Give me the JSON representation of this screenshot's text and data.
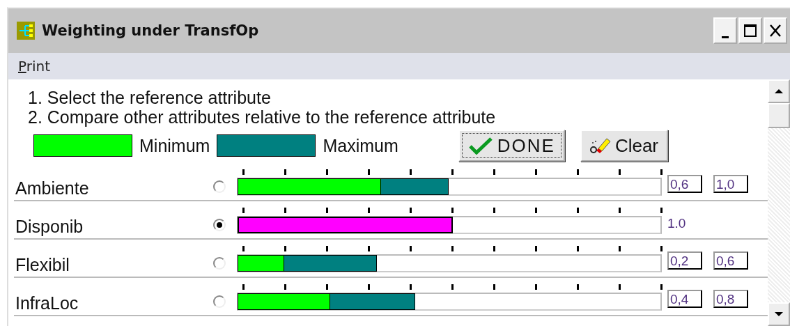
{
  "window": {
    "title": "Weighting under TransfOp"
  },
  "menu": [
    {
      "label": "Print"
    }
  ],
  "instructions": [
    "1. Select the reference attribute",
    "2. Compare other attributes relative to the reference attribute"
  ],
  "legend": [
    {
      "label": "Minimum",
      "color": "#00ff00"
    },
    {
      "label": "Maximum",
      "color": "#008080"
    }
  ],
  "buttons": [
    {
      "label": "DONE",
      "kind": "done",
      "focused": true
    },
    {
      "label": "Clear",
      "kind": "clear",
      "focused": false
    }
  ],
  "attributes": [
    {
      "name": "Ambiente",
      "kind": "compare",
      "selected": false,
      "min": {
        "level": 0.34,
        "value": "0,6"
      },
      "max": {
        "level": 0.5,
        "value": "1,0"
      }
    },
    {
      "name": "Disponib",
      "kind": "reference",
      "selected": true,
      "level": 0.51,
      "reading": "1.0"
    },
    {
      "name": "Flexibil",
      "kind": "compare",
      "selected": false,
      "min": {
        "level": 0.11,
        "value": "0,2"
      },
      "max": {
        "level": 0.33,
        "value": "0,6"
      }
    },
    {
      "name": "InfraLoc",
      "kind": "compare",
      "selected": false,
      "min": {
        "level": 0.22,
        "value": "0,4"
      },
      "max": {
        "level": 0.42,
        "value": "0,8"
      }
    }
  ]
}
